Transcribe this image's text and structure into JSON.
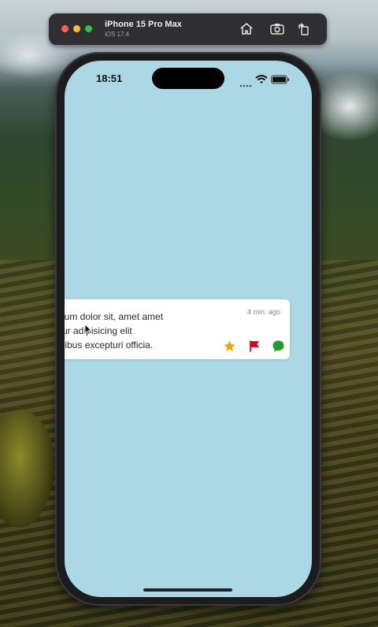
{
  "simulator": {
    "title": "iPhone 15 Pro Max",
    "subtitle": "iOS 17.4",
    "icons": [
      "home-icon",
      "screenshot-icon",
      "rotate-icon"
    ]
  },
  "status_bar": {
    "time": "18:51",
    "icons": [
      "cellular-dots-icon",
      "wifi-icon",
      "battery-icon"
    ]
  },
  "notification": {
    "lines": [
      "osum dolor sit, amet amet",
      "etur adipisicing elit",
      "tatibus excepturi officia."
    ],
    "timestamp": "4 min. ago",
    "actions": [
      {
        "name": "favorite",
        "icon": "star-icon",
        "color": "#f0a500"
      },
      {
        "name": "flag",
        "icon": "flag-icon",
        "color": "#e0001a"
      },
      {
        "name": "reply",
        "icon": "chat-bubble-icon",
        "color": "#1e9e2a"
      }
    ]
  },
  "colors": {
    "screen_background": "#acd8e6",
    "card_background": "#ffffff"
  }
}
